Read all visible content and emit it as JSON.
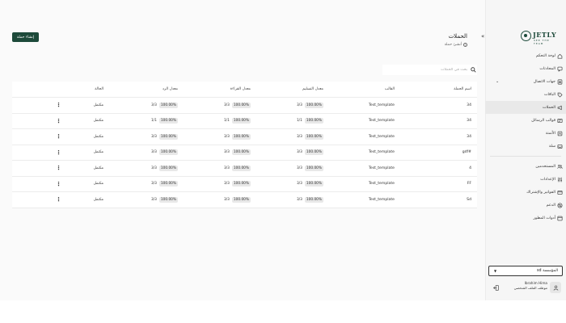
{
  "brand": {
    "name": "JETLY",
    "tagline": "SEE THE TEAM"
  },
  "sidebar": {
    "items": [
      {
        "label": "لوحة التحكم",
        "icon": "home-icon"
      },
      {
        "label": "المحادثات",
        "icon": "chat-icon"
      },
      {
        "label": "جهات الاتصال",
        "icon": "contacts-icon",
        "expandable": true
      },
      {
        "label": "الباقات",
        "icon": "tag-icon"
      },
      {
        "label": "الحملات",
        "icon": "campaign-icon",
        "active": true
      },
      {
        "label": "قوالب الرسائل",
        "icon": "template-icon"
      },
      {
        "label": "الأتمتة",
        "icon": "automation-icon"
      },
      {
        "label": "سلة",
        "icon": "inbox-icon"
      }
    ],
    "items2": [
      {
        "label": "المستخدمين",
        "icon": "users-icon"
      },
      {
        "label": "الإعدادات",
        "icon": "settings-icon"
      },
      {
        "label": "الفواتير والإشتراك",
        "icon": "billing-icon"
      },
      {
        "label": "الدعم",
        "icon": "support-icon"
      },
      {
        "label": "أدوات المطور",
        "icon": "developer-icon"
      }
    ],
    "org_select": "المؤسسة sd",
    "user": {
      "name": "Ibrahim Hima",
      "role": "موظف الملف الشخصي"
    }
  },
  "header": {
    "title": "الحملات",
    "subtitle": "أنشئ حملة",
    "create_button": "إنشاء حملة",
    "search_placeholder": "بحث في الحملات"
  },
  "table": {
    "columns": {
      "name": "اسم الحملة",
      "template": "القالب",
      "delivery": "معدل التسليم",
      "read": "معدل القراءة",
      "reply": "معدل الرد",
      "status": "الحالة"
    },
    "rows": [
      {
        "name": "34",
        "template": "Test_template",
        "delivery_pct": "100.00%",
        "delivery_frac": "3/3",
        "read_pct": "100.00%",
        "read_frac": "3/3",
        "reply_pct": "100.00%",
        "reply_frac": "3/3",
        "status": "مكتمل"
      },
      {
        "name": "34",
        "template": "Test_template",
        "delivery_pct": "100.00%",
        "delivery_frac": "1/1",
        "read_pct": "100.00%",
        "read_frac": "1/1",
        "reply_pct": "100.00%",
        "reply_frac": "1/1",
        "status": "مكتمل"
      },
      {
        "name": "34",
        "template": "Test_template",
        "delivery_pct": "100.00%",
        "delivery_frac": "3/3",
        "read_pct": "100.00%",
        "read_frac": "3/3",
        "reply_pct": "100.00%",
        "reply_frac": "3/3",
        "status": "مكتمل"
      },
      {
        "name": "#gdf",
        "template": "Test_template",
        "delivery_pct": "100.00%",
        "delivery_frac": "3/3",
        "read_pct": "100.00%",
        "read_frac": "3/3",
        "reply_pct": "100.00%",
        "reply_frac": "3/3",
        "status": "مكتمل"
      },
      {
        "name": "4",
        "template": "Test_template",
        "delivery_pct": "100.00%",
        "delivery_frac": "3/3",
        "read_pct": "100.00%",
        "read_frac": "3/3",
        "reply_pct": "100.00%",
        "reply_frac": "3/3",
        "status": "مكتمل"
      },
      {
        "name": "FF",
        "template": "Test_template",
        "delivery_pct": "100.00%",
        "delivery_frac": "3/3",
        "read_pct": "100.00%",
        "read_frac": "3/3",
        "reply_pct": "100.00%",
        "reply_frac": "3/3",
        "status": "مكتمل"
      },
      {
        "name": "Sd",
        "template": "Test_template",
        "delivery_pct": "100.00%",
        "delivery_frac": "3/3",
        "read_pct": "100.00%",
        "read_frac": "3/3",
        "reply_pct": "100.00%",
        "reply_frac": "3/3",
        "status": "مكتمل"
      }
    ]
  },
  "colors": {
    "brand": "#1d4a3a",
    "sidebar_bg": "#f6f6f6",
    "active_bg": "#e9e9e9",
    "pill_bg": "#e8e8e8"
  }
}
